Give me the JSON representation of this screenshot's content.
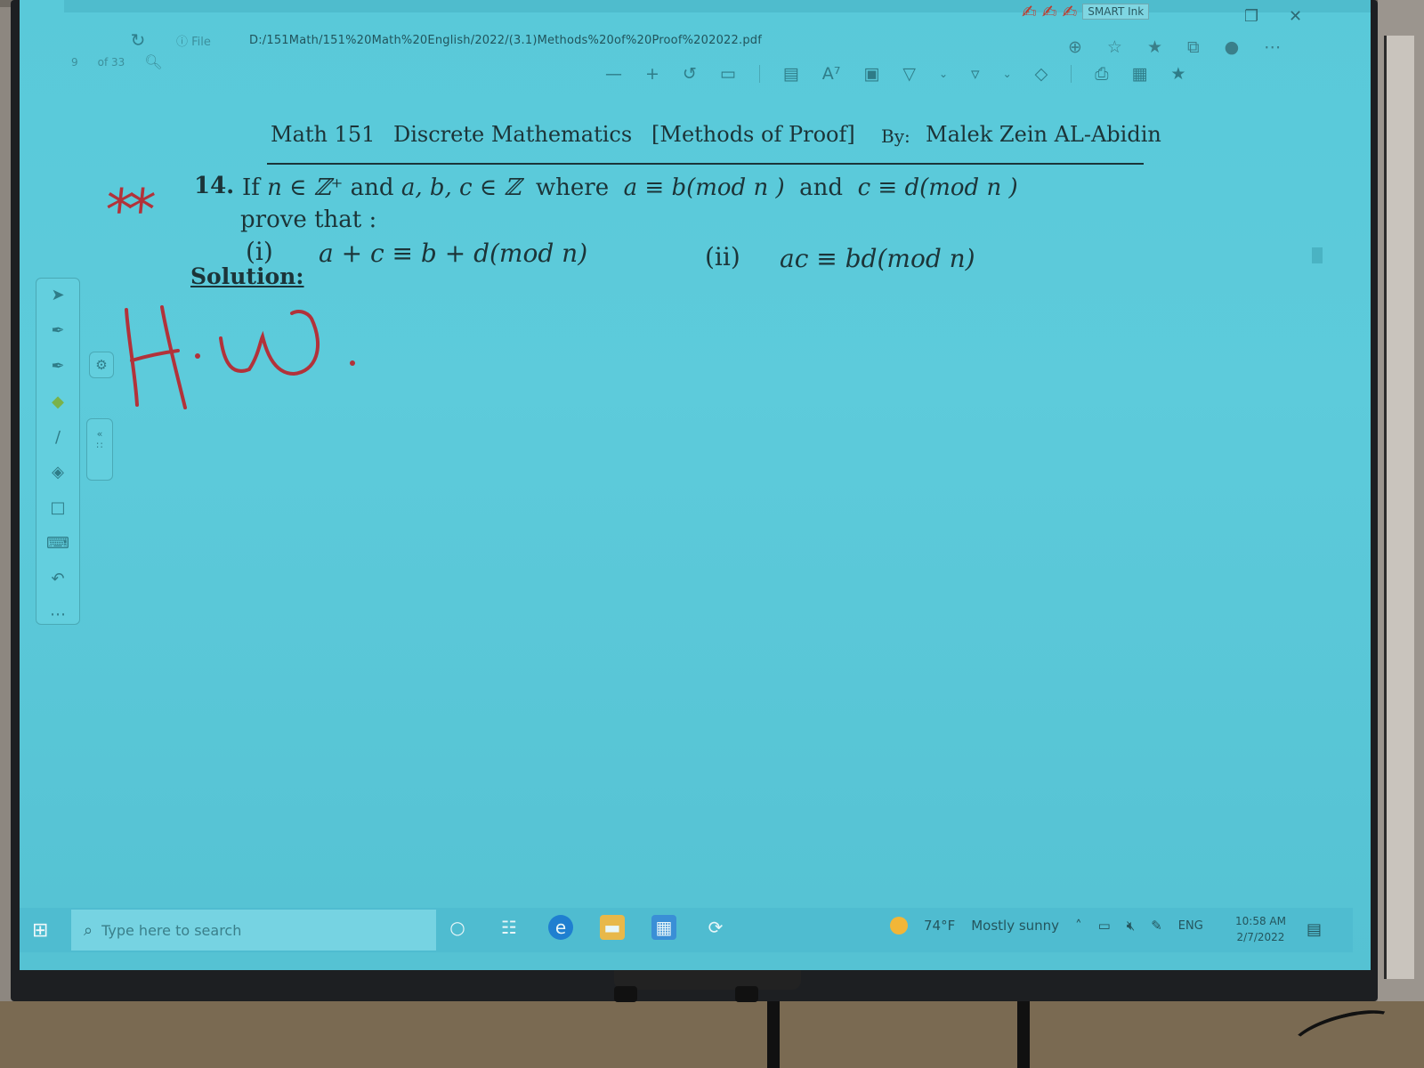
{
  "browser": {
    "url_prefix": "File",
    "url": "D:/151Math/151%20Math%20English/2022/(3.1)Methods%20of%20Proof%202022.pdf",
    "page_current": "9",
    "page_total": "of 33",
    "smart_ink_label": "SMART Ink"
  },
  "document": {
    "header": {
      "course": "Math 151",
      "subject": "Discrete Mathematics",
      "topic": "[Methods of Proof]",
      "by_label": "By:",
      "author": "Malek Zein AL-Abidin"
    },
    "annotation_stars": "**",
    "problem": {
      "number": "14.",
      "text_if": "If",
      "cond1": "n ∈ ℤ⁺",
      "text_and1": "and",
      "cond2": "a, b, c ∈ ℤ",
      "text_where": "where",
      "cond3": "a ≡ b(mod n )",
      "text_and2": "and",
      "cond4": "c ≡ d(mod n )",
      "prove": "prove  that :",
      "part_i_label": "(i)",
      "part_i": "a + c ≡ b + d(mod n)",
      "part_ii_label": "(ii)",
      "part_ii": "ac ≡ bd(mod n)"
    },
    "solution_label": "Solution:",
    "handwritten": "H.W."
  },
  "taskbar": {
    "search_placeholder": "Type here to search",
    "weather_temp": "74°F",
    "weather_desc": "Mostly sunny",
    "lang": "ENG",
    "time": "10:58 AM",
    "date": "2/7/2022"
  },
  "colors": {
    "screen": "#5dcbdb",
    "ink_red": "#b2323a",
    "text": "#1c3438",
    "taskbar": "#4fbcd0"
  }
}
